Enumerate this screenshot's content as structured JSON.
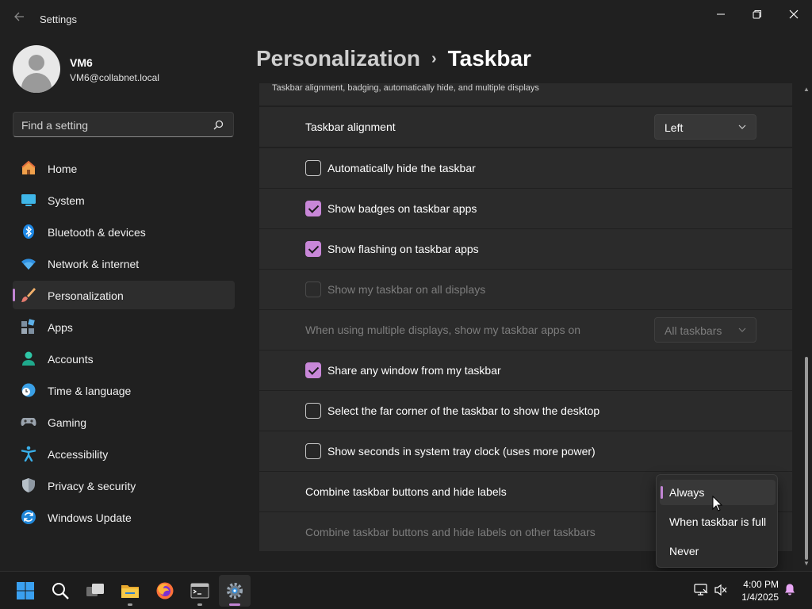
{
  "app": {
    "title": "Settings"
  },
  "user": {
    "name": "VM6",
    "email": "VM6@collabnet.local"
  },
  "search": {
    "placeholder": "Find a setting"
  },
  "nav": {
    "items": [
      {
        "label": "Home"
      },
      {
        "label": "System"
      },
      {
        "label": "Bluetooth & devices"
      },
      {
        "label": "Network & internet"
      },
      {
        "label": "Personalization"
      },
      {
        "label": "Apps"
      },
      {
        "label": "Accounts"
      },
      {
        "label": "Time & language"
      },
      {
        "label": "Gaming"
      },
      {
        "label": "Accessibility"
      },
      {
        "label": "Privacy & security"
      },
      {
        "label": "Windows Update"
      }
    ],
    "active_index": 4
  },
  "header": {
    "parent": "Personalization",
    "separator": "›",
    "current": "Taskbar"
  },
  "section": {
    "subtitle": "Taskbar alignment, badging, automatically hide, and multiple displays"
  },
  "settings": {
    "alignment": {
      "label": "Taskbar alignment",
      "value": "Left"
    },
    "auto_hide": {
      "label": "Automatically hide the taskbar",
      "checked": false
    },
    "badges": {
      "label": "Show badges on taskbar apps",
      "checked": true
    },
    "flashing": {
      "label": "Show flashing on taskbar apps",
      "checked": true
    },
    "all_displays": {
      "label": "Show my taskbar on all displays",
      "checked": false,
      "disabled": true
    },
    "multi_display": {
      "label": "When using multiple displays, show my taskbar apps on",
      "value": "All taskbars",
      "disabled": true
    },
    "share_window": {
      "label": "Share any window from my taskbar",
      "checked": true
    },
    "far_corner": {
      "label": "Select the far corner of the taskbar to show the desktop",
      "checked": false
    },
    "seconds": {
      "label": "Show seconds in system tray clock (uses more power)",
      "checked": false
    },
    "combine": {
      "label": "Combine taskbar buttons and hide labels"
    },
    "combine_other": {
      "label": "Combine taskbar buttons and hide labels on other taskbars",
      "disabled": true
    }
  },
  "combine_menu": {
    "options": [
      "Always",
      "When taskbar is full",
      "Never"
    ],
    "selected": "Always"
  },
  "clock": {
    "time": "4:00 PM",
    "date": "1/4/2025"
  },
  "colors": {
    "accent": "#c285d4",
    "background": "#202020",
    "card": "#2b2b2b"
  }
}
